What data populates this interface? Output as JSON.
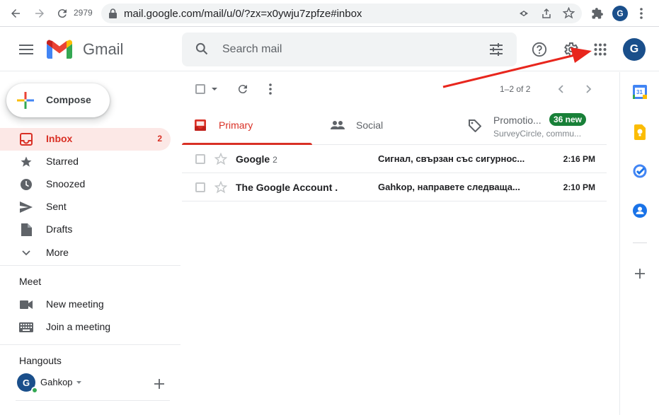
{
  "browser": {
    "tab_count": "2979",
    "url": "mail.google.com/mail/u/0/?zx=x0ywju7zpfze#inbox",
    "profile_initial": "G"
  },
  "header": {
    "app_name": "Gmail",
    "search_placeholder": "Search mail",
    "account_initial": "G"
  },
  "sidebar": {
    "compose_label": "Compose",
    "items": [
      {
        "label": "Inbox",
        "count": "2"
      },
      {
        "label": "Starred"
      },
      {
        "label": "Snoozed"
      },
      {
        "label": "Sent"
      },
      {
        "label": "Drafts"
      },
      {
        "label": "More"
      }
    ],
    "meet": {
      "title": "Meet",
      "items": [
        {
          "label": "New meeting"
        },
        {
          "label": "Join a meeting"
        }
      ]
    },
    "hangouts": {
      "title": "Hangouts",
      "user_name": "Gahkop",
      "user_initial": "G"
    }
  },
  "toolbar": {
    "pagination": "1–2 of 2"
  },
  "tabs": [
    {
      "label": "Primary"
    },
    {
      "label": "Social"
    },
    {
      "label": "Promotio...",
      "badge": "36 new",
      "subtitle": "SurveyCircle, commu..."
    }
  ],
  "emails": [
    {
      "sender": "Google",
      "count": "2",
      "subject": "Сигнал, свързан със сигурнос...",
      "time": "2:16 PM"
    },
    {
      "sender": "The Google Account .",
      "count": "",
      "subject": "Gahkop, направете следваща...",
      "time": "2:10 PM"
    }
  ],
  "rail": {
    "calendar_day": "31"
  },
  "colors": {
    "accent_red": "#d93025",
    "active_bg": "#fce8e6",
    "badge_green": "#188038",
    "avatar_blue": "#1a4f8b",
    "annotation_arrow": "#e8261d"
  }
}
